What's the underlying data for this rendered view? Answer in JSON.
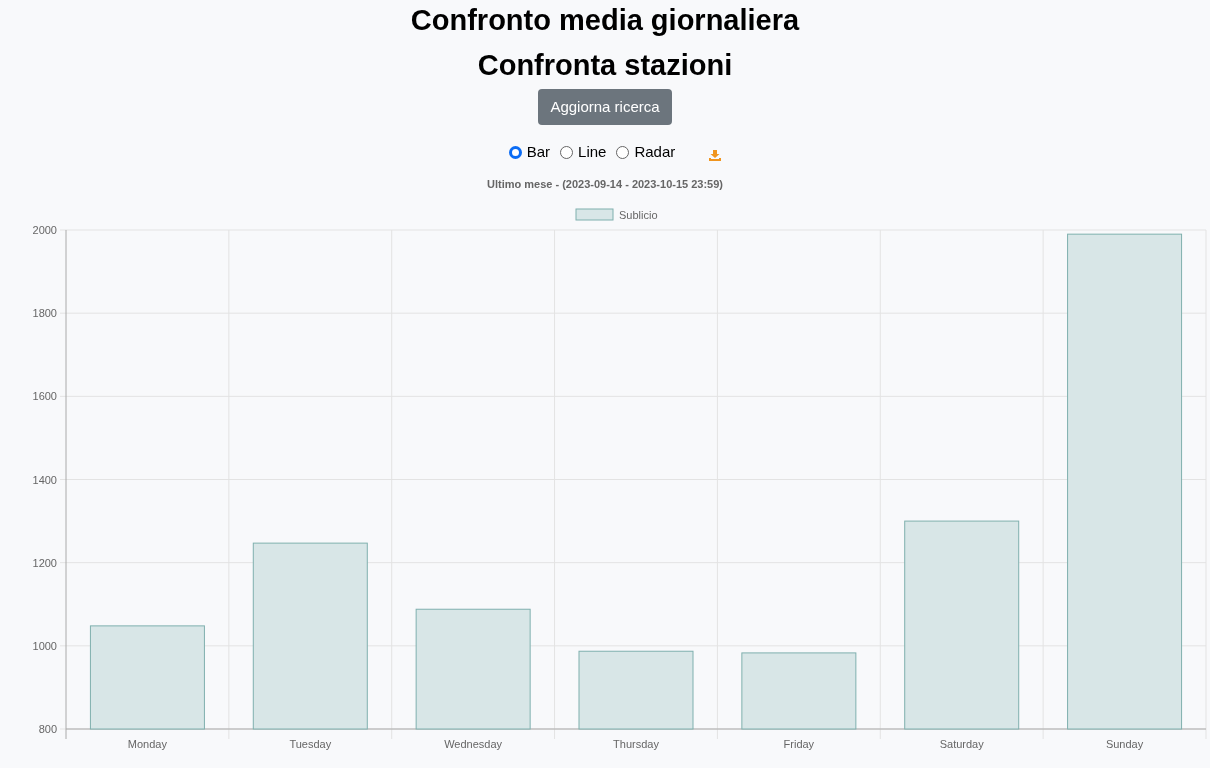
{
  "title": "Confronto media giornaliera",
  "subtitle": "Confronta stazioni",
  "button": "Aggiorna ricerca",
  "chart_types": [
    {
      "label": "Bar",
      "selected": true
    },
    {
      "label": "Line",
      "selected": false
    },
    {
      "label": "Radar",
      "selected": false
    }
  ],
  "period": "Ultimo mese - (2023-09-14 - 2023-10-15 23:59)",
  "chart_data": {
    "type": "bar",
    "categories": [
      "Monday",
      "Tuesday",
      "Wednesday",
      "Thursday",
      "Friday",
      "Saturday",
      "Sunday"
    ],
    "series": [
      {
        "name": "Sublicio",
        "color": "#d8e6e7",
        "values": [
          1048,
          1247,
          1088,
          987,
          983,
          1300,
          1990
        ]
      }
    ],
    "grid": true,
    "ylim": [
      800,
      2000
    ],
    "yticks": [
      800,
      1000,
      1200,
      1400,
      1600,
      1800,
      2000
    ]
  }
}
